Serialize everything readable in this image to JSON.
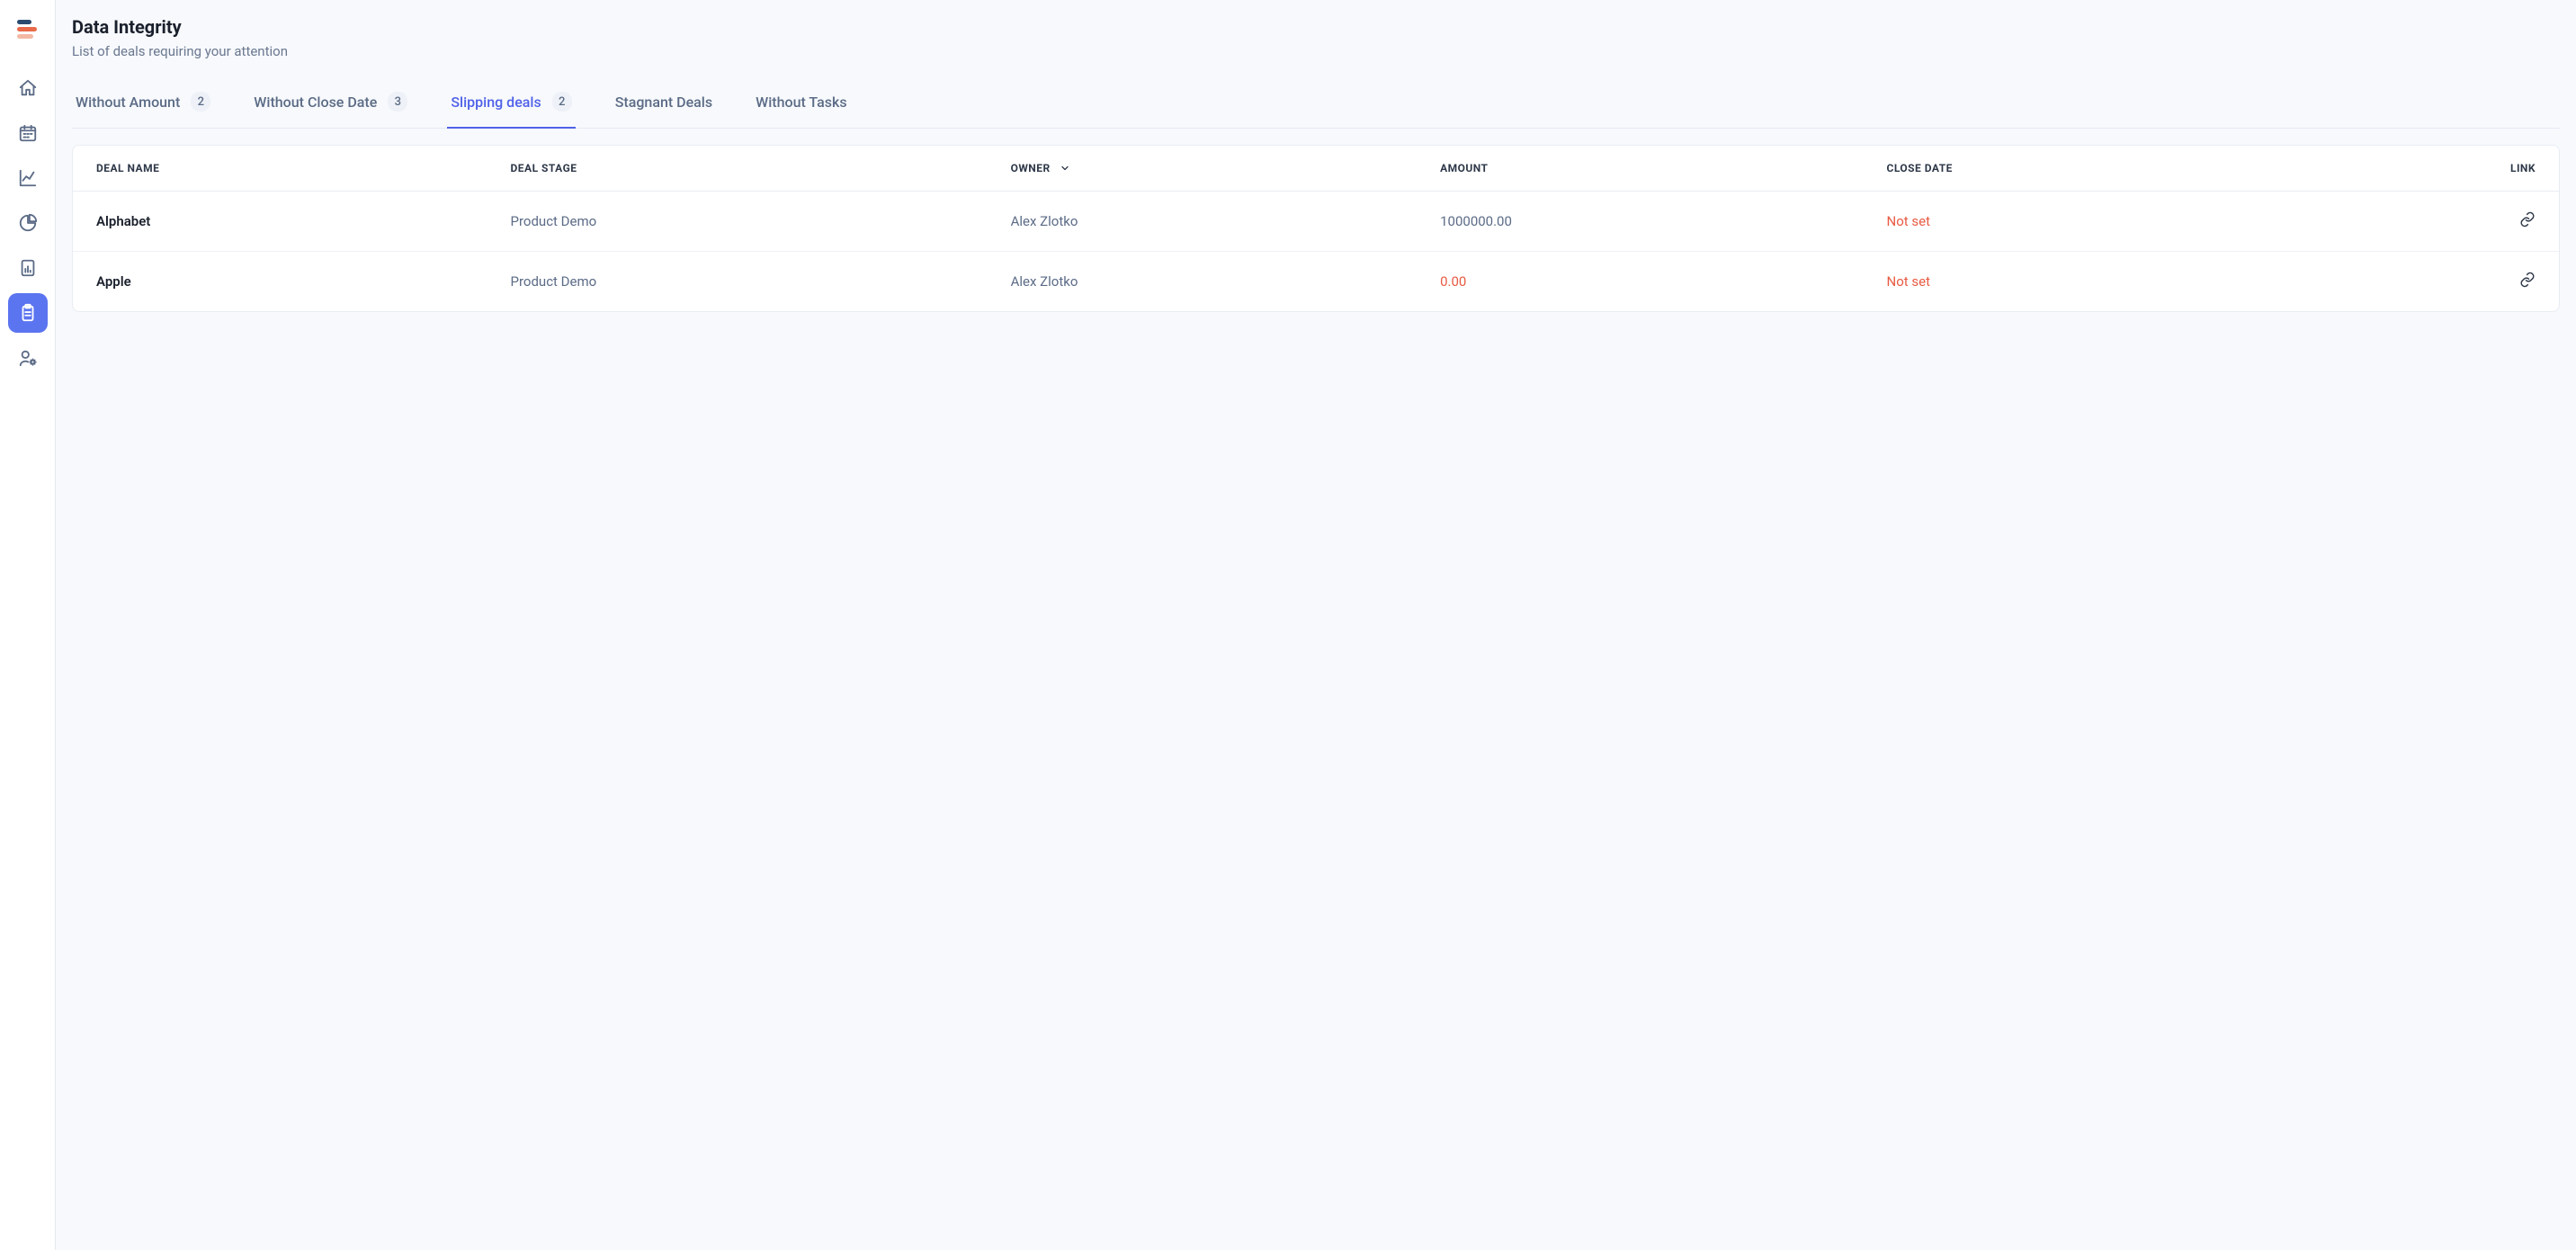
{
  "header": {
    "title": "Data Integrity",
    "subtitle": "List of deals requiring your attention"
  },
  "tabs": [
    {
      "label": "Without Amount",
      "count": "2",
      "active": false
    },
    {
      "label": "Without Close Date",
      "count": "3",
      "active": false
    },
    {
      "label": "Slipping deals",
      "count": "2",
      "active": true
    },
    {
      "label": "Stagnant Deals",
      "count": null,
      "active": false
    },
    {
      "label": "Without Tasks",
      "count": null,
      "active": false
    }
  ],
  "table": {
    "columns": {
      "deal_name": "Deal Name",
      "deal_stage": "Deal Stage",
      "owner": "Owner",
      "amount": "Amount",
      "close_date": "Close Date",
      "link": "Link"
    },
    "rows": [
      {
        "deal_name": "Alphabet",
        "deal_stage": "Product Demo",
        "owner": "Alex Zlotko",
        "amount": "1000000.00",
        "amount_warn": false,
        "close_date": "Not set",
        "close_date_warn": true
      },
      {
        "deal_name": "Apple",
        "deal_stage": "Product Demo",
        "owner": "Alex Zlotko",
        "amount": "0.00",
        "amount_warn": true,
        "close_date": "Not set",
        "close_date_warn": true
      }
    ]
  }
}
